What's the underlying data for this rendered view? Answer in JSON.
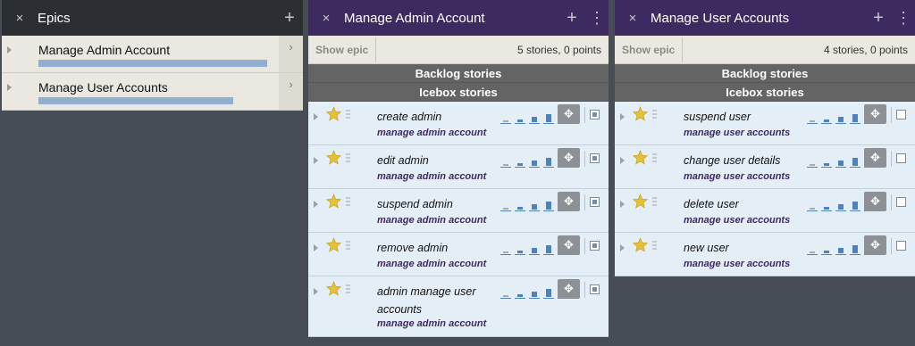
{
  "epics_panel": {
    "title": "Epics",
    "close_icon": "×",
    "add_icon": "+",
    "items": [
      {
        "name": "Manage Admin Account",
        "progress": 1.0
      },
      {
        "name": "Manage User Accounts",
        "progress": 0.85
      }
    ]
  },
  "admin_panel": {
    "title": "Manage Admin Account",
    "close_icon": "×",
    "add_icon": "+",
    "more_icon": "⋮",
    "show_epic_label": "Show epic",
    "summary": "5 stories, 0 points",
    "backlog_label": "Backlog stories",
    "icebox_label": "Icebox stories",
    "stories": [
      {
        "title": "create admin",
        "label": "manage admin account"
      },
      {
        "title": "edit admin",
        "label": "manage admin account"
      },
      {
        "title": "suspend admin",
        "label": "manage admin account"
      },
      {
        "title": "remove admin",
        "label": "manage admin account"
      },
      {
        "title": "admin manage user accounts",
        "label": "manage admin account"
      }
    ]
  },
  "users_panel": {
    "title": "Manage User Accounts",
    "close_icon": "×",
    "add_icon": "+",
    "more_icon": "⋮",
    "show_epic_label": "Show epic",
    "summary": "4 stories, 0 points",
    "backlog_label": "Backlog stories",
    "icebox_label": "Icebox stories",
    "stories": [
      {
        "title": "suspend user",
        "label": "manage user accounts"
      },
      {
        "title": "change user details",
        "label": "manage user accounts"
      },
      {
        "title": "delete user",
        "label": "manage user accounts"
      },
      {
        "title": "new user",
        "label": "manage user accounts"
      }
    ]
  },
  "icons": {
    "star": "star-icon",
    "move": "move-icon",
    "caret": "caret-right-icon",
    "chevron": "chevron-right-icon"
  },
  "colors": {
    "epic_header": "#2b2e33",
    "story_header": "#3d2a61",
    "epic_progress": "#92aece",
    "story_bg": "#e4eef6",
    "star": "#e5c13a"
  }
}
